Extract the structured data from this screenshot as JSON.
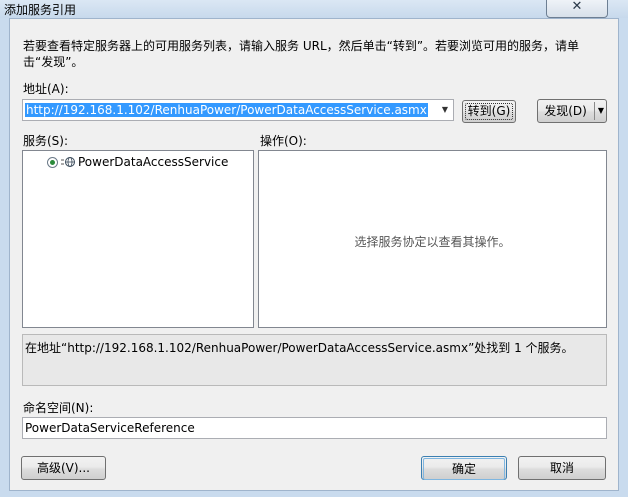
{
  "window": {
    "title": "添加服务引用",
    "close_label": "✕"
  },
  "instruction": "若要查看特定服务器上的可用服务列表，请输入服务 URL，然后单击“转到”。若要浏览可用的服务，请单击“发现”。",
  "address": {
    "label": "地址(A):",
    "value": "http://192.168.1.102/RenhuaPower/PowerDataAccessService.asmx"
  },
  "buttons": {
    "go": "转到(G)",
    "discover": "发现(D)",
    "advanced": "高级(V)...",
    "ok": "确定",
    "cancel": "取消"
  },
  "services": {
    "label": "服务(S):",
    "items": [
      {
        "label": "PowerDataAccessService",
        "icon": "service-globe-icon"
      }
    ]
  },
  "operations": {
    "label": "操作(O):",
    "empty_message": "选择服务协定以查看其操作。"
  },
  "status": "在地址“http://192.168.1.102/RenhuaPower/PowerDataAccessService.asmx”处找到 1 个服务。",
  "namespace": {
    "label": "命名空间(N):",
    "value": "PowerDataServiceReference"
  },
  "colors": {
    "selection": "#3399ff",
    "window_frame": "#c9dbee",
    "dialog_background": "#f0f0f0"
  }
}
